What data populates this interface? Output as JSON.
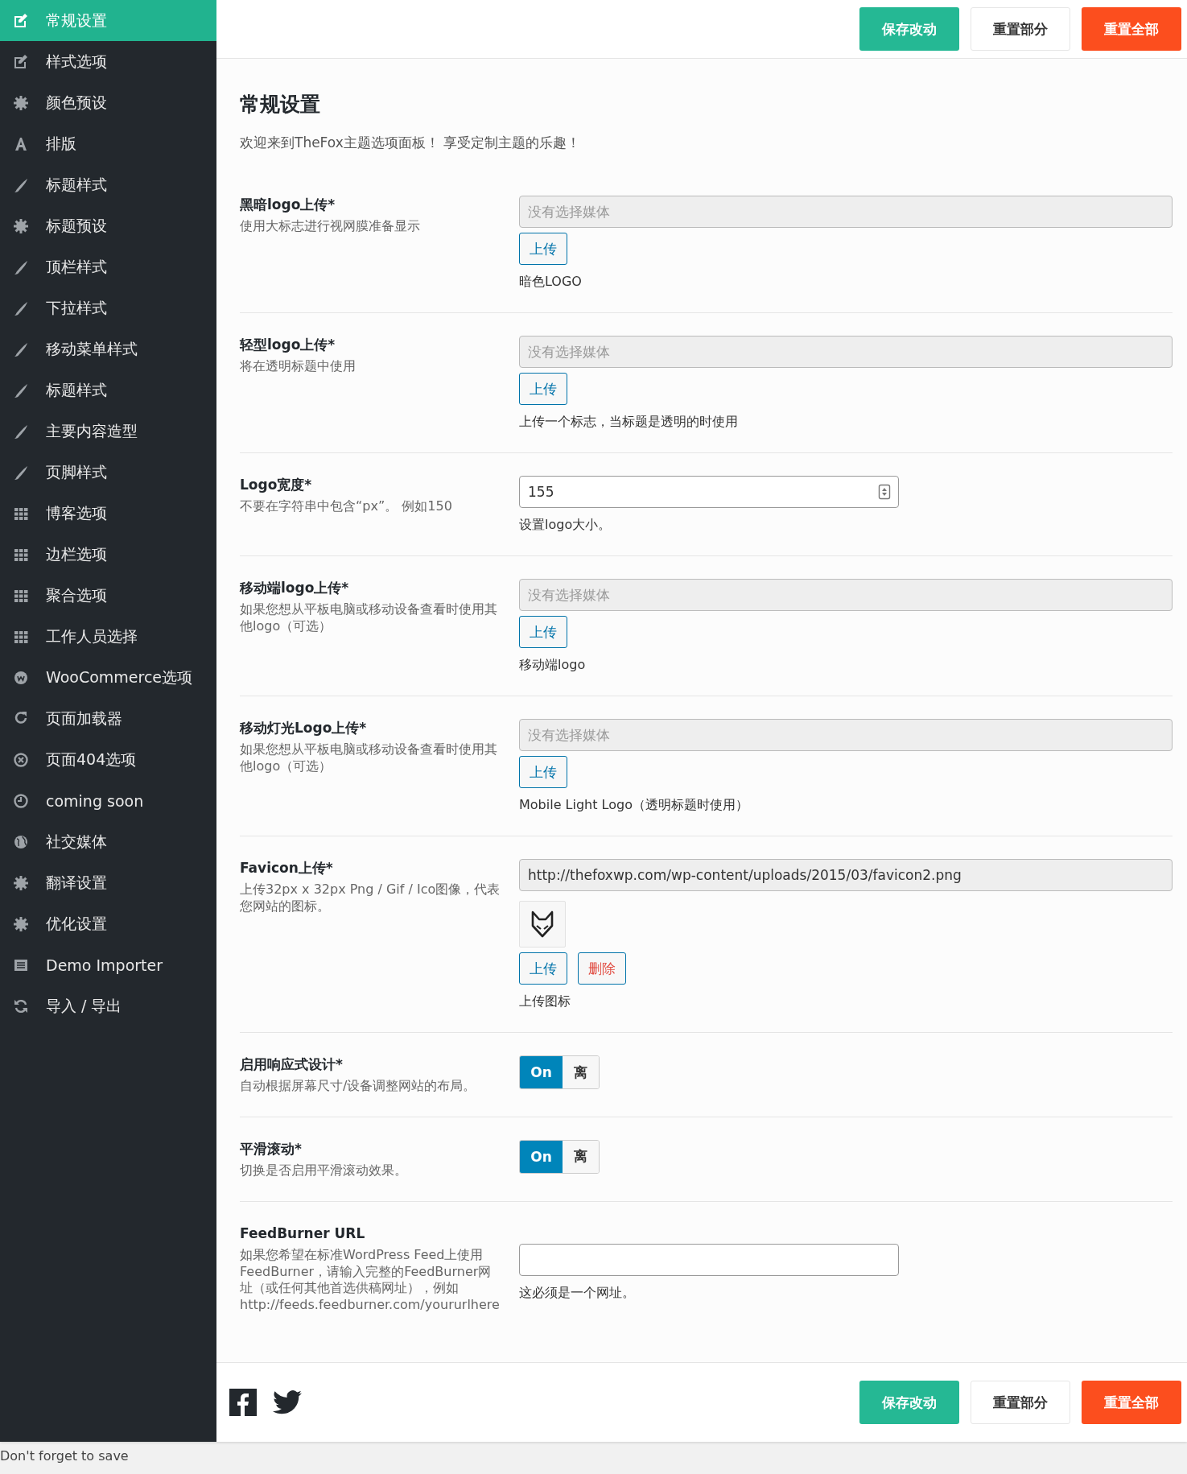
{
  "sidebar": {
    "items": [
      {
        "label": "常规设置",
        "selected": true
      },
      {
        "label": "样式选项",
        "selected": false
      },
      {
        "label": "颜色预设",
        "selected": false
      },
      {
        "label": "排版",
        "selected": false
      },
      {
        "label": "标题样式",
        "selected": false
      },
      {
        "label": "标题预设",
        "selected": false
      },
      {
        "label": "顶栏样式",
        "selected": false
      },
      {
        "label": "下拉样式",
        "selected": false
      },
      {
        "label": "移动菜单样式",
        "selected": false
      },
      {
        "label": "标题样式",
        "selected": false
      },
      {
        "label": "主要内容造型",
        "selected": false
      },
      {
        "label": "页脚样式",
        "selected": false
      },
      {
        "label": "博客选项",
        "selected": false
      },
      {
        "label": "边栏选项",
        "selected": false
      },
      {
        "label": "聚合选项",
        "selected": false
      },
      {
        "label": "工作人员选择",
        "selected": false
      },
      {
        "label": "WooCommerce选项",
        "selected": false
      },
      {
        "label": "页面加载器",
        "selected": false
      },
      {
        "label": "页面404选项",
        "selected": false
      },
      {
        "label": "coming soon",
        "selected": false
      },
      {
        "label": "社交媒体",
        "selected": false
      },
      {
        "label": "翻译设置",
        "selected": false
      },
      {
        "label": "优化设置",
        "selected": false
      },
      {
        "label": "Demo Importer",
        "selected": false
      },
      {
        "label": "导入 / 导出",
        "selected": false
      }
    ]
  },
  "toolbar": {
    "buttons": [
      {
        "label": "保存改动",
        "kind": "save"
      },
      {
        "label": "重置部分",
        "kind": "reset"
      },
      {
        "label": "重置全部",
        "kind": "reset_all"
      }
    ]
  },
  "page": {
    "title": "常规设置",
    "intro": "欢迎来到TheFox主题选项面板！ 享受定制主题的乐趣！"
  },
  "fields": [
    {
      "kind": "media",
      "title": "黑暗logo上传*",
      "desc": "使用大标志进行视网膜准备显示",
      "placeholder": "没有选择媒体",
      "buttons": [
        {
          "label": "上传",
          "kind": "upload"
        }
      ],
      "note": "暗色LOGO"
    },
    {
      "kind": "media",
      "title": "轻型logo上传*",
      "desc": "将在透明标题中使用",
      "placeholder": "没有选择媒体",
      "buttons": [
        {
          "label": "上传",
          "kind": "upload"
        }
      ],
      "note": "上传一个标志，当标题是透明的时使用"
    },
    {
      "kind": "number",
      "title": "Logo宽度*",
      "desc": "不要在字符串中包含“px”。 例如150",
      "value": "155",
      "note": "设置logo大小。"
    },
    {
      "kind": "media",
      "title": "移动端logo上传*",
      "desc": "如果您想从平板电脑或移动设备查看时使用其他logo（可选）",
      "placeholder": "没有选择媒体",
      "buttons": [
        {
          "label": "上传",
          "kind": "upload"
        }
      ],
      "note": "移动端logo"
    },
    {
      "kind": "media",
      "title": "移动灯光Logo上传*",
      "desc": "如果您想从平板电脑或移动设备查看时使用其他logo（可选）",
      "placeholder": "没有选择媒体",
      "buttons": [
        {
          "label": "上传",
          "kind": "upload"
        }
      ],
      "note": "Mobile Light Logo（透明标题时使用）"
    },
    {
      "kind": "favicon",
      "title": "Favicon上传*",
      "desc": "上传32px x 32px Png / Gif / Ico图像，代表您网站的图标。",
      "value": "http://thefoxwp.com/wp-content/uploads/2015/03/favicon2.png",
      "buttons": [
        {
          "label": "上传",
          "kind": "upload"
        },
        {
          "label": "删除",
          "kind": "remove"
        }
      ],
      "note": "上传图标"
    },
    {
      "kind": "switch",
      "title": "启用响应式设计*",
      "desc": "自动根据屏幕尺寸/设备调整网站的布局。",
      "on": true,
      "on_label": "On",
      "off_label": "离"
    },
    {
      "kind": "switch",
      "title": "平滑滚动*",
      "desc": "切换是否启用平滑滚动效果。",
      "on": true,
      "on_label": "On",
      "off_label": "离"
    },
    {
      "kind": "text",
      "title": "FeedBurner URL",
      "desc": "如果您希望在标准WordPress Feed上使用FeedBurner，请输入完整的FeedBurner网址（或任何其他首选供稿网址），例如 http://feeds.feedburner.com/yoururlhere",
      "note": "这必须是一个网址。"
    }
  ],
  "footer": {
    "buttons": [
      {
        "label": "保存改动",
        "kind": "save"
      },
      {
        "label": "重置部分",
        "kind": "reset"
      },
      {
        "label": "重置全部",
        "kind": "reset_all"
      }
    ]
  },
  "save_notice": "Don't forget to save"
}
